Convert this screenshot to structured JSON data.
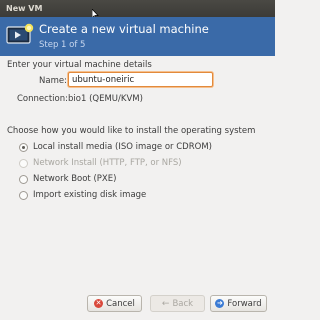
{
  "window": {
    "title": "New VM"
  },
  "header": {
    "title": "Create a new virtual machine",
    "step": "Step 1 of 5"
  },
  "details": {
    "section_label": "Enter your virtual machine details",
    "name_label": "Name:",
    "name_value": "ubuntu-oneiric",
    "connection_label": "Connection:",
    "connection_value": "bio1 (QEMU/KVM)"
  },
  "install": {
    "section_label": "Choose how you would like to install the operating system",
    "options": [
      {
        "label": "Local install media (ISO image or CDROM)",
        "selected": true,
        "enabled": true
      },
      {
        "label": "Network Install (HTTP, FTP, or NFS)",
        "selected": false,
        "enabled": false
      },
      {
        "label": "Network Boot (PXE)",
        "selected": false,
        "enabled": true
      },
      {
        "label": "Import existing disk image",
        "selected": false,
        "enabled": true
      }
    ]
  },
  "buttons": {
    "cancel": "Cancel",
    "back": "Back",
    "forward": "Forward"
  },
  "icons": {
    "window_cursor": "mouse-pointer-icon",
    "header": "new-vm-monitor-icon",
    "cancel": "cancel-icon",
    "back": "back-arrow-icon",
    "forward": "forward-icon"
  },
  "colors": {
    "header_bg": "#3a6aa8",
    "focus_border": "#e28a3c",
    "titlebar": "#3c3b37"
  }
}
